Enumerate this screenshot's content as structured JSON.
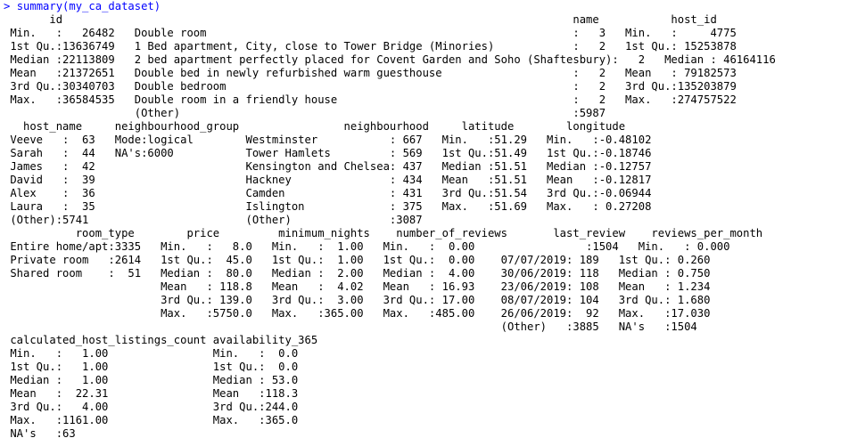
{
  "console": {
    "prompt": "> ",
    "command": "summary(my_ca_dataset)",
    "output_lines": [
      "       id                                                                              name           host_id       ",
      " Min.   :   26482   Double room                                                        :   3   Min.   :     4775  ",
      " 1st Qu.:13636749   1 Bed apartment, City, close to Tower Bridge (Minories)            :   2   1st Qu.: 15253878  ",
      " Median :22113809   2 bed apartment perfectly placed for Covent Garden and Soho (Shaftesbury):   2   Median : 46164116  ",
      " Mean   :21372651   Double bed in newly refurbished warm guesthouse                    :   2   Mean   : 79182573  ",
      " 3rd Qu.:30340703   Double bedroom                                                     :   2   3rd Qu.:135203879  ",
      " Max.   :36584535   Double room in a friendly house                                    :   2   Max.   :274757522  ",
      "                    (Other)                                                            :5987                      ",
      "   host_name     neighbourhood_group                neighbourhood     latitude        longitude       ",
      " Veeve   :  63   Mode:logical        Westminster           : 667   Min.   :51.29   Min.   :-0.48102  ",
      " Sarah   :  44   NA's:6000           Tower Hamlets         : 569   1st Qu.:51.49   1st Qu.:-0.18746  ",
      " James   :  42                       Kensington and Chelsea: 437   Median :51.51   Median :-0.12757  ",
      " David   :  39                       Hackney               : 434   Mean   :51.51   Mean   :-0.12817  ",
      " Alex    :  36                       Camden                : 431   3rd Qu.:51.54   3rd Qu.:-0.06944  ",
      " Laura   :  35                       Islington             : 375   Max.   :51.69   Max.   : 0.27208  ",
      " (Other):5741                        (Other)               :3087                                     ",
      "           room_type        price         minimum_nights    number_of_reviews       last_review    reviews_per_month",
      " Entire home/apt:3335   Min.   :   8.0   Min.   :  1.00   Min.   :  0.00                 :1504   Min.   : 0.000   ",
      " Private room   :2614   1st Qu.:  45.0   1st Qu.:  1.00   1st Qu.:  0.00    07/07/2019: 189   1st Qu.: 0.260   ",
      " Shared room    :  51   Median :  80.0   Median :  2.00   Median :  4.00    30/06/2019: 118   Median : 0.750   ",
      "                        Mean   : 118.8   Mean   :  4.02   Mean   : 16.93    23/06/2019: 108   Mean   : 1.234   ",
      "                        3rd Qu.: 139.0   3rd Qu.:  3.00   3rd Qu.: 17.00    08/07/2019: 104   3rd Qu.: 1.680   ",
      "                        Max.   :5750.0   Max.   :365.00   Max.   :485.00    26/06/2019:  92   Max.   :17.030   ",
      "                                                                            (Other)   :3885   NA's   :1504     ",
      " calculated_host_listings_count availability_365",
      " Min.   :   1.00                Min.   :  0.0   ",
      " 1st Qu.:   1.00                1st Qu.:  0.0   ",
      " Median :   1.00                Median : 53.0   ",
      " Mean   :  22.31                Mean   :118.3   ",
      " 3rd Qu.:   4.00                3rd Qu.:244.0   ",
      " Max.   :1161.00                Max.   :365.0   ",
      " NA's   :63                                     "
    ]
  },
  "colors": {
    "command": "#0000ff",
    "output": "#000000",
    "background": "#ffffff"
  }
}
